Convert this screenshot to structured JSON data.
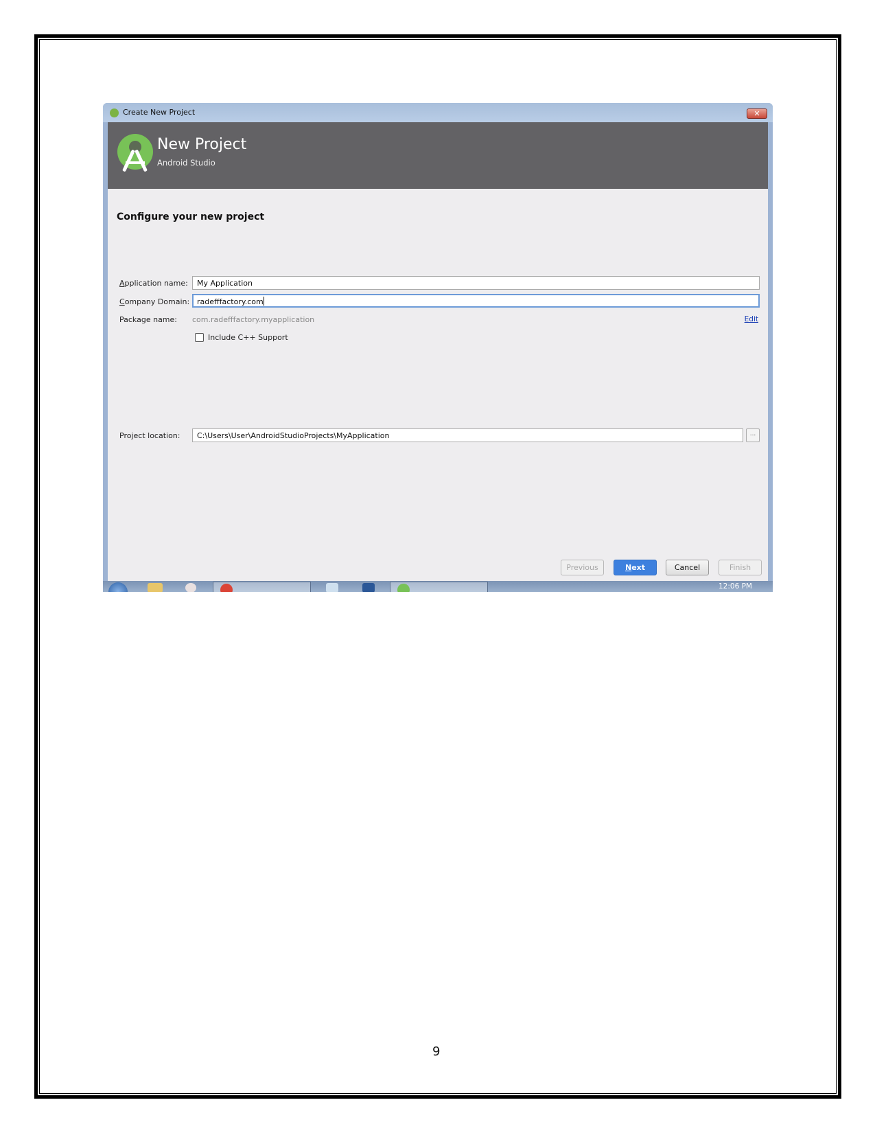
{
  "window": {
    "title": "Create New Project",
    "close_symbol": "✕"
  },
  "header": {
    "title": "New Project",
    "subtitle": "Android Studio"
  },
  "form": {
    "section_title": "Configure your new project",
    "application_name": {
      "label_accel": "A",
      "label_rest": "pplication name:",
      "value": "My Application"
    },
    "company_domain": {
      "label_accel": "C",
      "label_rest": "ompany Domain:",
      "value": "radefffactory.com"
    },
    "package_name": {
      "label": "Package name:",
      "value": "com.radefffactory.myapplication",
      "edit_label": "Edit"
    },
    "cpp_support": {
      "label": "Include C++ Support",
      "checked": false
    },
    "project_location": {
      "label": "Project location:",
      "value": "C:\\Users\\User\\AndroidStudioProjects\\MyApplication",
      "browse_label": "..."
    }
  },
  "buttons": {
    "previous": "Previous",
    "next_accel": "N",
    "next_rest": "ext",
    "cancel": "Cancel",
    "finish": "Finish"
  },
  "taskbar": {
    "time": "12:06 PM"
  },
  "page": {
    "number": "9"
  }
}
